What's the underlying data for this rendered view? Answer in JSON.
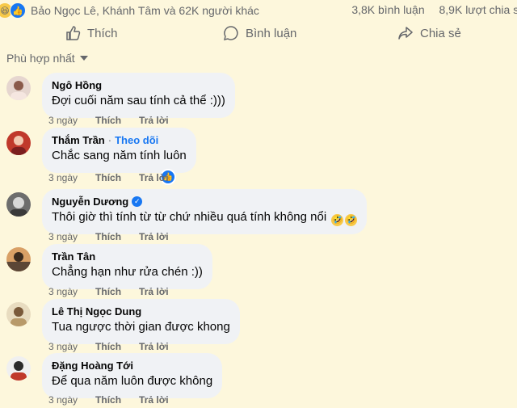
{
  "post": {
    "reactors": "Bảo Ngọc Lê, Khánh Tâm và 62K người khác",
    "comment_count": "3,8K bình luận",
    "share_count": "8,9K lượt chia sẻ"
  },
  "actions": {
    "like": "Thích",
    "comment": "Bình luận",
    "share": "Chia sẻ"
  },
  "sort_label": "Phù hợp nhất",
  "comments": [
    {
      "author": "Ngô Hồng",
      "text": "Đợi cuối năm sau tính cả thể :)))",
      "time": "3 ngày",
      "like": "Thích",
      "reply": "Trả lời"
    },
    {
      "author": "Thắm Trần",
      "follow": "Theo dõi",
      "text": "Chắc sang năm tính luôn",
      "time": "3 ngày",
      "like": "Thích",
      "reply": "Trả lời"
    },
    {
      "author": "Nguyễn Dương",
      "text": "Thôi giờ thì tính từ từ chứ nhiều quá tính không nổi",
      "time": "3 ngày",
      "like": "Thích",
      "reply": "Trả lời"
    },
    {
      "author": "Trần Tân",
      "text": "Chẳng hạn như rửa chén :))",
      "time": "3 ngày",
      "like": "Thích",
      "reply": "Trả lời"
    },
    {
      "author": "Lê Thị Ngọc Dung",
      "text": "Tua ngược thời gian được khong",
      "time": "3 ngày",
      "like": "Thích",
      "reply": "Trả lời"
    },
    {
      "author": "Đặng Hoàng Tới",
      "text": "Để qua năm luôn được không",
      "time": "3 ngày",
      "like": "Thích",
      "reply": "Trả lời"
    }
  ]
}
